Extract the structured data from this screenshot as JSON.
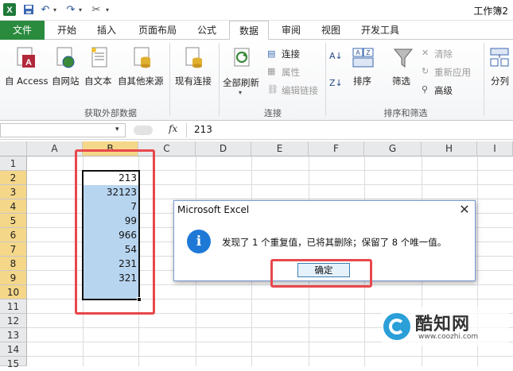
{
  "window": {
    "title": "工作簿2"
  },
  "quick_access": {
    "save": "save-icon",
    "undo": "undo-icon",
    "redo": "redo-icon",
    "customize": "customize-icon"
  },
  "tabs": [
    "文件",
    "开始",
    "插入",
    "页面布局",
    "公式",
    "数据",
    "审阅",
    "视图",
    "开发工具"
  ],
  "active_tab": "数据",
  "ribbon": {
    "get_external": {
      "label": "获取外部数据",
      "buttons": [
        "自 Access",
        "自网站",
        "自文本",
        "自其他来源",
        "现有连接"
      ]
    },
    "connections": {
      "label": "连接",
      "refresh_all": "全部刷新",
      "connect": "连接",
      "properties": "属性",
      "edit_links": "编辑链接"
    },
    "sort_filter": {
      "label": "排序和筛选",
      "sort": "排序",
      "filter": "筛选",
      "clear": "清除",
      "reapply": "重新应用",
      "advanced": "高级"
    },
    "split": "分列"
  },
  "formula_bar": {
    "fx": "fx",
    "value": "213"
  },
  "columns": [
    "A",
    "B",
    "C",
    "D",
    "E",
    "F",
    "G",
    "H",
    "I"
  ],
  "rows": [
    "1",
    "2",
    "3",
    "4",
    "5",
    "6",
    "7",
    "8",
    "9",
    "10",
    "11",
    "12",
    "13",
    "14",
    "15"
  ],
  "cells_B": [
    "213",
    "32123",
    "7",
    "99",
    "966",
    "54",
    "231",
    "321"
  ],
  "dialog": {
    "title": "Microsoft Excel",
    "message": "发现了 1 个重复值，已将其删除；保留了 8 个唯一值。",
    "ok": "确定",
    "icon": "info-icon"
  },
  "watermark": {
    "name": "酷知网",
    "url": "www.coozhi.com"
  },
  "colors": {
    "file_tab": "#2a8a3e",
    "selection": "#b8d5f0",
    "highlight": "#e8474c",
    "info": "#1e79d6"
  }
}
